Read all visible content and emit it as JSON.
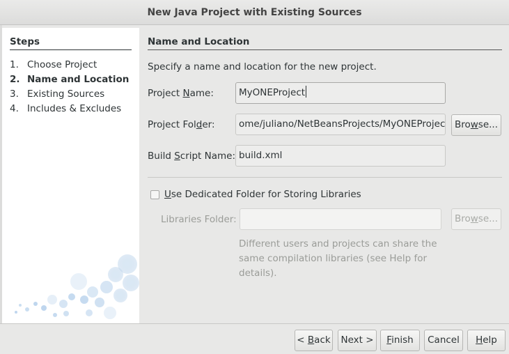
{
  "window": {
    "title": "New Java Project with Existing Sources"
  },
  "steps": {
    "title": "Steps",
    "items": [
      {
        "num": "1.",
        "label": "Choose Project"
      },
      {
        "num": "2.",
        "label": "Name and Location"
      },
      {
        "num": "3.",
        "label": "Existing Sources"
      },
      {
        "num": "4.",
        "label": "Includes & Excludes"
      }
    ]
  },
  "section": {
    "title": "Name and Location",
    "description": "Specify a name and location for the new project."
  },
  "form": {
    "project_name": {
      "label_a": "Project ",
      "label_u": "N",
      "label_b": "ame:",
      "value": "MyONEProject"
    },
    "project_folder": {
      "label_a": "Project Fol",
      "label_u": "d",
      "label_b": "er:",
      "value": "ome/juliano/NetBeansProjects/MyONEProject"
    },
    "build_script": {
      "label_a": "Build ",
      "label_u": "S",
      "label_b": "cript Name:",
      "value": "build.xml"
    },
    "browse": {
      "a": "Bro",
      "u": "w",
      "b": "se..."
    },
    "dedicated_folder": {
      "u": "U",
      "b": "se Dedicated Folder for Storing Libraries",
      "checked": false
    },
    "libraries_folder": {
      "label": "Libraries Folder:",
      "value": ""
    },
    "browse_disabled": {
      "a": "Bro",
      "u": "w",
      "b": "se..."
    },
    "help_text": "Different users and projects can share the same compilation libraries (see Help for details)."
  },
  "buttons": {
    "back": {
      "a": "< ",
      "u": "B",
      "b": "ack"
    },
    "next": "Next >",
    "finish": {
      "u": "F",
      "b": "inish"
    },
    "cancel": "Cancel",
    "help": {
      "u": "H",
      "b": "elp"
    }
  }
}
